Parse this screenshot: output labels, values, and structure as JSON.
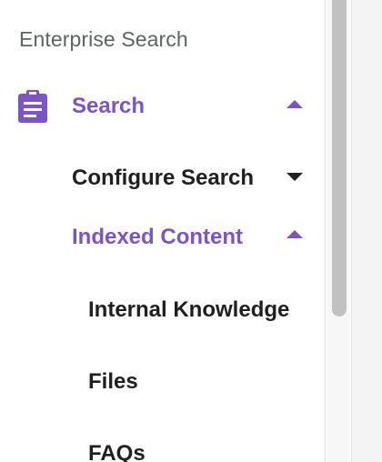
{
  "sidebar": {
    "section_header": "Enterprise Search",
    "search": {
      "label": "Search",
      "icon": "clipboard-icon",
      "expanded": true
    },
    "configure_search": {
      "label": "Configure Search",
      "expanded": false
    },
    "indexed_content": {
      "label": "Indexed Content",
      "expanded": true,
      "items": [
        {
          "label": "Internal Knowledge"
        },
        {
          "label": "Files"
        },
        {
          "label": "FAQs"
        }
      ]
    }
  },
  "colors": {
    "accent": "#7b55c7",
    "text": "#1f1f1f",
    "header_text": "#5f6368"
  }
}
